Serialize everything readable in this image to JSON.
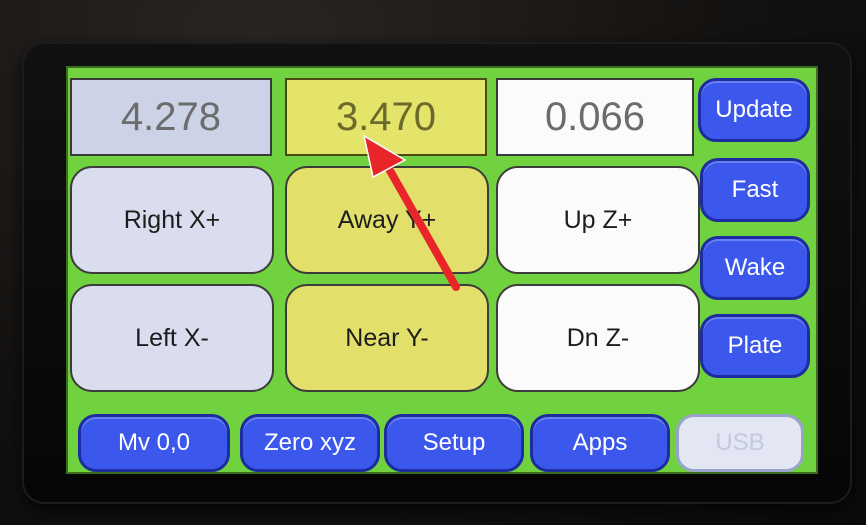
{
  "readouts": {
    "x": "4.278",
    "y": "3.470",
    "z": "0.066"
  },
  "jog_buttons": {
    "right_x_plus": "Right X+",
    "away_y_plus": "Away Y+",
    "up_z_plus": "Up Z+",
    "left_x_minus": "Left X-",
    "near_y_minus": "Near Y-",
    "dn_z_minus": "Dn Z-"
  },
  "side_buttons": {
    "update": "Update",
    "fast": "Fast",
    "wake": "Wake",
    "plate": "Plate"
  },
  "bottom_buttons": {
    "mv00": "Mv 0,0",
    "zero_xyz": "Zero xyz",
    "setup": "Setup",
    "apps": "Apps",
    "usb": "USB"
  },
  "colors": {
    "screen_background": "#6fd23e",
    "button_blue": "#3b57ec",
    "x_axis": "#d9dded",
    "y_axis": "#e2df6a",
    "z_axis": "#fbfbfb",
    "annotation_arrow": "#e8262a"
  },
  "annotation": {
    "arrow_icon": "red-arrow-icon"
  }
}
